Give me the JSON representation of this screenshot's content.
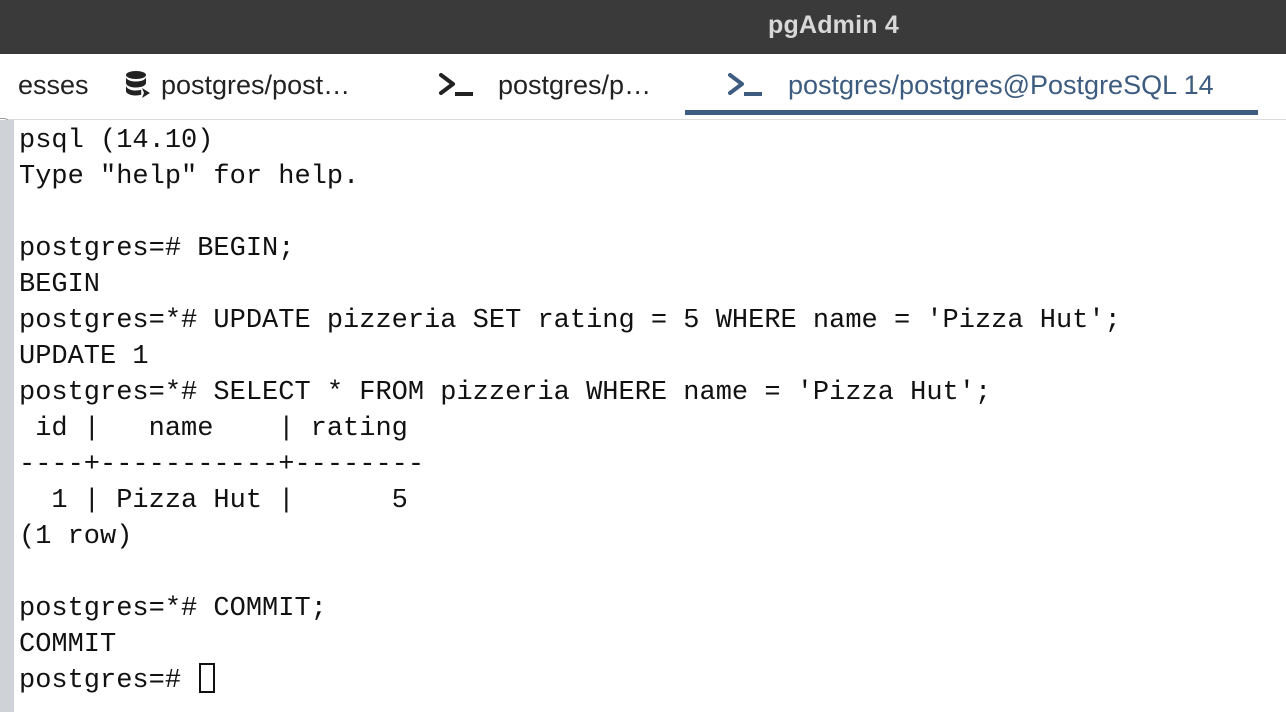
{
  "window": {
    "title": "pgAdmin 4"
  },
  "tabs": [
    {
      "label": "esses",
      "icon": "none",
      "active": false
    },
    {
      "label": "postgres/post…",
      "icon": "database-icon",
      "active": false
    },
    {
      "label": "postgres/p…",
      "icon": "terminal-prompt-icon",
      "active": false
    },
    {
      "label": "postgres/postgres@PostgreSQL 14",
      "icon": "terminal-prompt-icon",
      "active": true
    }
  ],
  "colors": {
    "titlebar": "#3a3a3a",
    "active_tab": "#3d5c80",
    "rail": "#cfd2d6"
  },
  "terminal": {
    "lines": [
      "psql (14.10)",
      "Type \"help\" for help.",
      "",
      "postgres=# BEGIN;",
      "BEGIN",
      "postgres=*# UPDATE pizzeria SET rating = 5 WHERE name = 'Pizza Hut';",
      "UPDATE 1",
      "postgres=*# SELECT * FROM pizzeria WHERE name = 'Pizza Hut';",
      " id |   name    | rating",
      "----+-----------+--------",
      "  1 | Pizza Hut |      5",
      "(1 row)",
      "",
      "postgres=*# COMMIT;",
      "COMMIT"
    ],
    "prompt": "postgres=# "
  }
}
